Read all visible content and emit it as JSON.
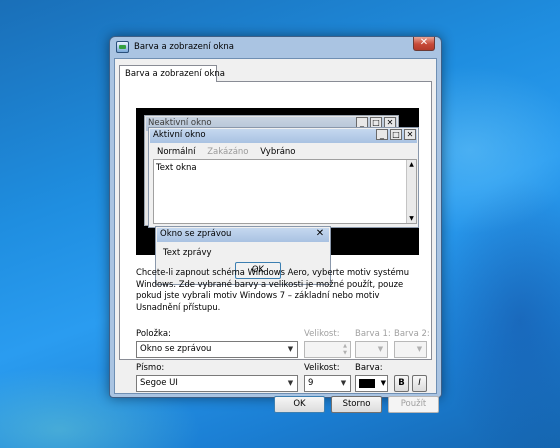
{
  "dialog": {
    "title": "Barva a zobrazení okna",
    "close_glyph": "✕",
    "tab_label": "Barva a zobrazení okna"
  },
  "preview": {
    "inactive_window_title": "Neaktivní okno",
    "active_window_title": "Aktivní okno",
    "caption_buttons": {
      "minimize": "_",
      "maximize": "□",
      "close": "✕"
    },
    "menu": [
      {
        "label": "Normální",
        "state": "normal"
      },
      {
        "label": "Zakázáno",
        "state": "disabled"
      },
      {
        "label": "Vybráno",
        "state": "selected"
      }
    ],
    "window_text": "Text okna",
    "message_box": {
      "title": "Okno se zprávou",
      "close_glyph": "✕",
      "text": "Text zprávy",
      "ok_label": "OK"
    }
  },
  "info_text": "Chcete-li zapnout schéma Windows Aero, vyberte motiv systému Windows. Zde vybrané barvy a velikosti je možné použít, pouze pokud jste vybrali motiv Windows 7 – základní nebo motiv Usnadnění přístupu.",
  "item": {
    "label": "Položka:",
    "value": "Okno se zprávou",
    "size_label": "Velikost:",
    "color1_label": "Barva 1:",
    "color2_label": "Barva 2:"
  },
  "font": {
    "label": "Písmo:",
    "value": "Segoe UI",
    "size_label": "Velikost:",
    "size_value": "9",
    "color_label": "Barva:",
    "color_value": "#000000",
    "bold_label": "B",
    "italic_label": "I"
  },
  "buttons": {
    "ok": "OK",
    "cancel": "Storno",
    "apply": "Použít"
  },
  "colors": {
    "desktop": "#1f8ee0",
    "dialog_frame": "#aac4e2",
    "close_button": "#c74a38"
  }
}
